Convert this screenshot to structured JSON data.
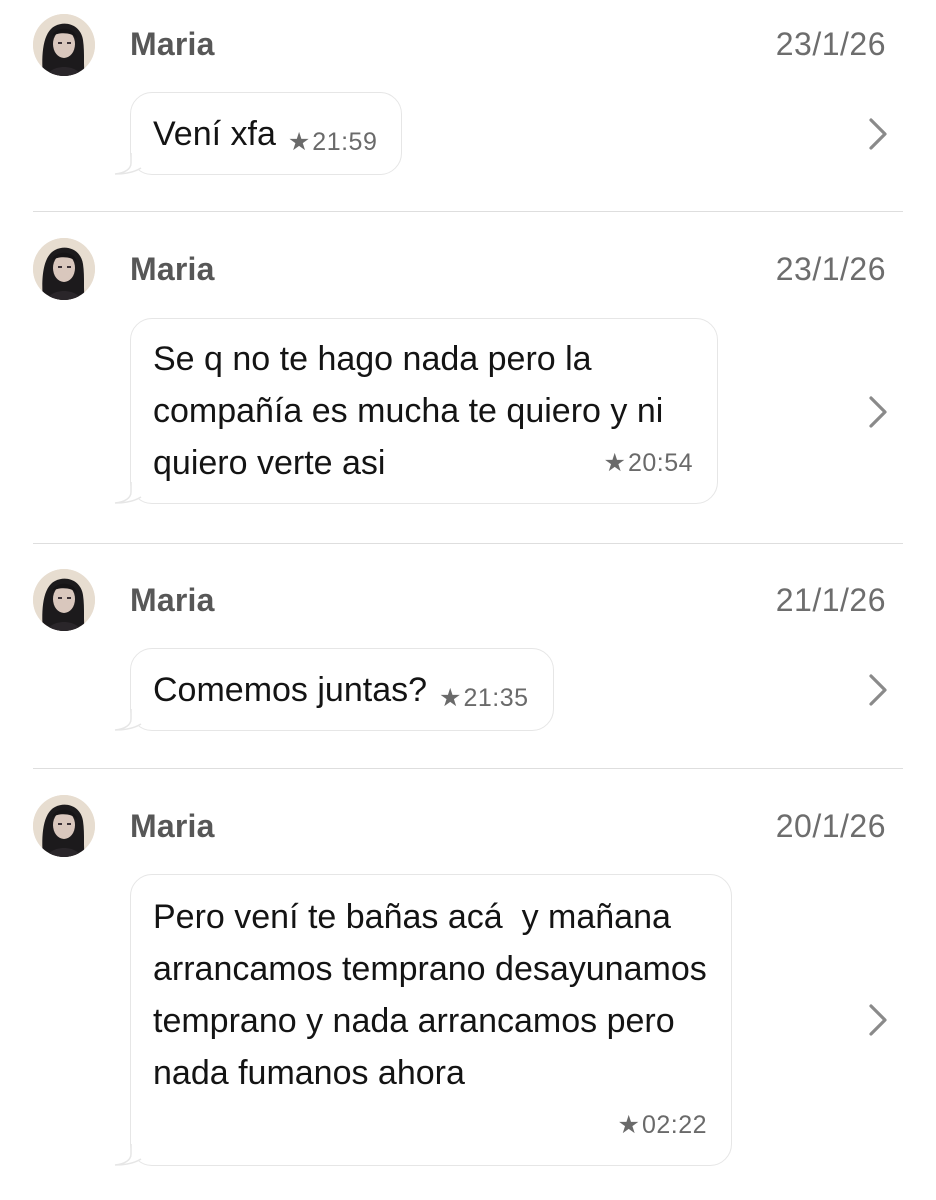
{
  "messages": [
    {
      "sender": "Maria",
      "date": "23/1/26",
      "text": "Vení xfa",
      "time": "21:59",
      "starred": true
    },
    {
      "sender": "Maria",
      "date": "23/1/26",
      "text": "Se q no te hago nada pero la compañía es mucha te quiero y ni quiero verte asi",
      "time": "20:54",
      "starred": true
    },
    {
      "sender": "Maria",
      "date": "21/1/26",
      "text": "Comemos juntas?",
      "time": "21:35",
      "starred": true
    },
    {
      "sender": "Maria",
      "date": "20/1/26",
      "text": "Pero vení te bañas acá  y mañana arrancamos temprano desayunamos temprano y nada arrancamos pero nada fumanos ahora",
      "time": "02:22",
      "starred": true
    }
  ],
  "icons": {
    "star": "star-icon",
    "chevron": "chevron-right-icon",
    "avatar": "contact-avatar"
  },
  "colors": {
    "sender": "#575757",
    "date": "#6d6d6d",
    "bubble_border": "#e6e6e6",
    "divider": "#dedede"
  }
}
